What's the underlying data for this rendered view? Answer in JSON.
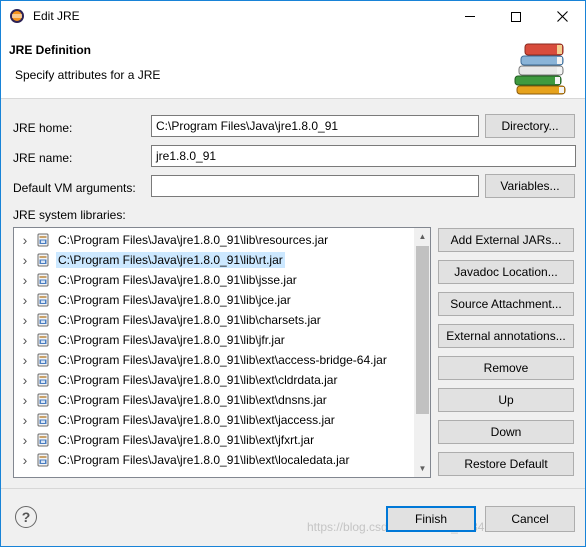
{
  "window": {
    "title": "Edit JRE",
    "icon": "eclipse-icon"
  },
  "banner": {
    "title": "JRE Definition",
    "description": "Specify attributes for a JRE",
    "graphic": "books-stack-icon"
  },
  "form": {
    "jre_home_label": "JRE home:",
    "jre_home_value": "C:\\Program Files\\Java\\jre1.8.0_91",
    "directory_button": "Directory...",
    "jre_name_label": "JRE name:",
    "jre_name_value": "jre1.8.0_91",
    "vm_args_label": "Default VM arguments:",
    "vm_args_value": "",
    "variables_button": "Variables...",
    "libraries_label": "JRE system libraries:"
  },
  "libraries": [
    {
      "path": "C:\\Program Files\\Java\\jre1.8.0_91\\lib\\resources.jar",
      "selected": false
    },
    {
      "path": "C:\\Program Files\\Java\\jre1.8.0_91\\lib\\rt.jar",
      "selected": true
    },
    {
      "path": "C:\\Program Files\\Java\\jre1.8.0_91\\lib\\jsse.jar",
      "selected": false
    },
    {
      "path": "C:\\Program Files\\Java\\jre1.8.0_91\\lib\\jce.jar",
      "selected": false
    },
    {
      "path": "C:\\Program Files\\Java\\jre1.8.0_91\\lib\\charsets.jar",
      "selected": false
    },
    {
      "path": "C:\\Program Files\\Java\\jre1.8.0_91\\lib\\jfr.jar",
      "selected": false
    },
    {
      "path": "C:\\Program Files\\Java\\jre1.8.0_91\\lib\\ext\\access-bridge-64.jar",
      "selected": false
    },
    {
      "path": "C:\\Program Files\\Java\\jre1.8.0_91\\lib\\ext\\cldrdata.jar",
      "selected": false
    },
    {
      "path": "C:\\Program Files\\Java\\jre1.8.0_91\\lib\\ext\\dnsns.jar",
      "selected": false
    },
    {
      "path": "C:\\Program Files\\Java\\jre1.8.0_91\\lib\\ext\\jaccess.jar",
      "selected": false
    },
    {
      "path": "C:\\Program Files\\Java\\jre1.8.0_91\\lib\\ext\\jfxrt.jar",
      "selected": false
    },
    {
      "path": "C:\\Program Files\\Java\\jre1.8.0_91\\lib\\ext\\localedata.jar",
      "selected": false
    }
  ],
  "side_buttons": {
    "add_external": "Add External JARs...",
    "javadoc": "Javadoc Location...",
    "source": "Source Attachment...",
    "annotations": "External annotations...",
    "remove": "Remove",
    "up": "Up",
    "down": "Down",
    "restore": "Restore Default"
  },
  "footer": {
    "help_icon": "?",
    "finish": "Finish",
    "cancel": "Cancel",
    "watermark": "https://blog.csdn.net/weixin_38347380"
  },
  "colors": {
    "accent": "#0078d7",
    "selection": "#cce8ff",
    "window_border": "#1883d7"
  }
}
